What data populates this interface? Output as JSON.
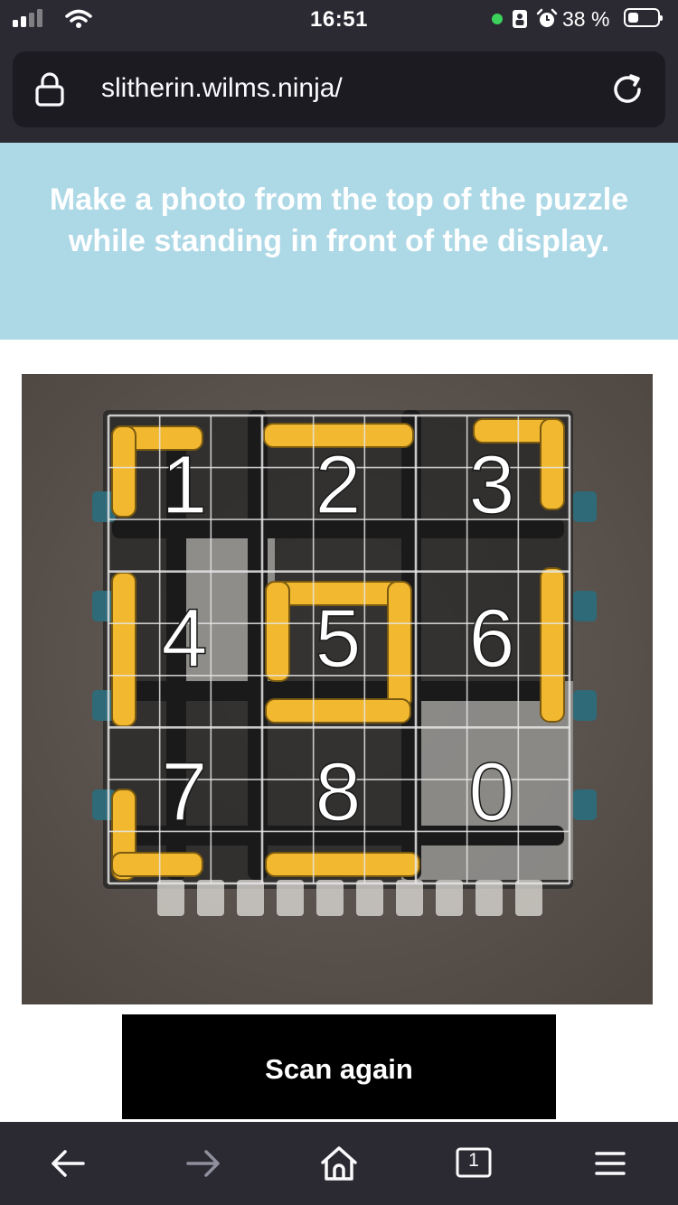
{
  "status_bar": {
    "time": "16:51",
    "battery_percent": "38 %",
    "battery_level": 0.38,
    "icons": [
      "signal-icon",
      "wifi-icon",
      "privacy-dot-icon",
      "portrait-lock-icon",
      "alarm-icon",
      "battery-icon"
    ]
  },
  "browser": {
    "url": "slitherin.wilms.ninja/",
    "icons": [
      "lock-icon",
      "reload-icon"
    ]
  },
  "page": {
    "instruction": "Make a photo from the top of the puzzle while standing in front of the display.",
    "scan_button_label": "Scan again"
  },
  "photo": {
    "grid_digits": [
      [
        "1",
        "2",
        "3"
      ],
      [
        "4",
        "5",
        "6"
      ],
      [
        "7",
        "8",
        "0"
      ]
    ],
    "colors": {
      "background": "#5a524c",
      "lego_yellow": "#f2b830",
      "lego_dark": "#242424",
      "lego_teal": "#2f6a78",
      "overlay_grid": "#e6e6e6"
    }
  },
  "toolbar": {
    "icons": [
      "back-arrow-icon",
      "forward-arrow-icon",
      "home-icon",
      "tabs-icon",
      "menu-icon"
    ],
    "tab_count": "1"
  },
  "colors": {
    "chrome": "#2b2a33",
    "url_field": "#1c1b22",
    "banner": "#add8e6",
    "button": "#000000"
  }
}
